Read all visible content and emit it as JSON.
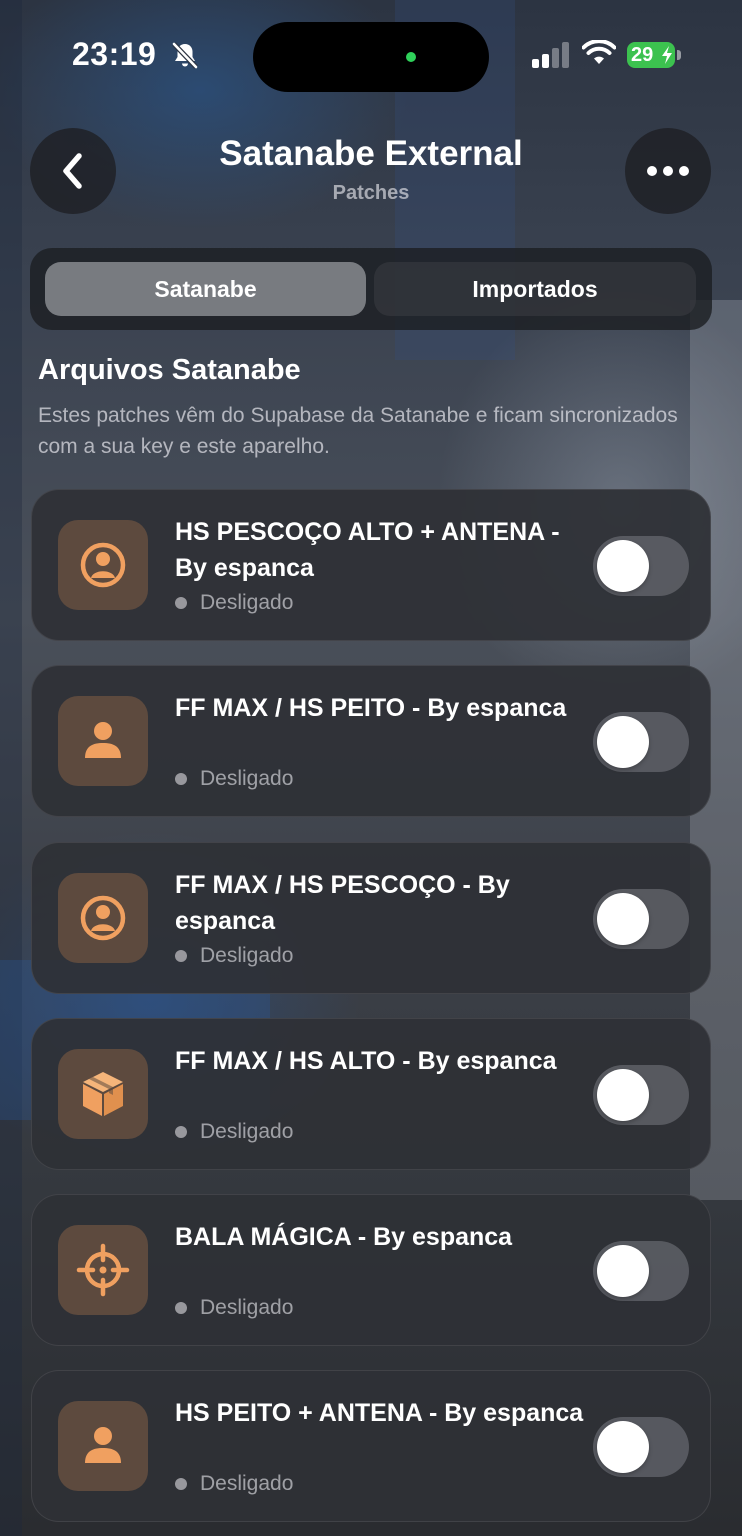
{
  "status_bar": {
    "time": "23:19",
    "battery_level": "29",
    "icons": [
      "bell-slash-icon",
      "cellular-signal-icon",
      "wifi-icon",
      "battery-charging-icon"
    ],
    "battery_color": "#3cc24f"
  },
  "nav": {
    "title": "Satanabe External",
    "subtitle": "Patches",
    "back_icon": "chevron-left-icon",
    "more_icon": "ellipsis-icon"
  },
  "tabs": [
    {
      "label": "Satanabe",
      "selected": true
    },
    {
      "label": "Importados",
      "selected": false
    }
  ],
  "section": {
    "title": "Arquivos Satanabe",
    "description": "Estes patches vêm do Supabase da Satanabe e ficam sincronizados com a sua key e este aparelho."
  },
  "accent_color": "#f0a060",
  "patches": [
    {
      "title": "HS PESCOÇO ALTO + ANTENA - By espanca",
      "status": "Desligado",
      "icon": "person-circle-icon",
      "enabled": false
    },
    {
      "title": "FF MAX / HS PEITO - By espanca",
      "status": "Desligado",
      "icon": "person-icon",
      "enabled": false
    },
    {
      "title": "FF MAX / HS PESCOÇO - By espanca",
      "status": "Desligado",
      "icon": "person-circle-icon",
      "enabled": false
    },
    {
      "title": "FF MAX / HS ALTO - By espanca",
      "status": "Desligado",
      "icon": "box-icon",
      "enabled": false
    },
    {
      "title": "BALA MÁGICA - By espanca",
      "status": "Desligado",
      "icon": "crosshair-icon",
      "enabled": false
    },
    {
      "title": "HS PEITO + ANTENA - By espanca",
      "status": "Desligado",
      "icon": "person-icon",
      "enabled": false
    }
  ]
}
